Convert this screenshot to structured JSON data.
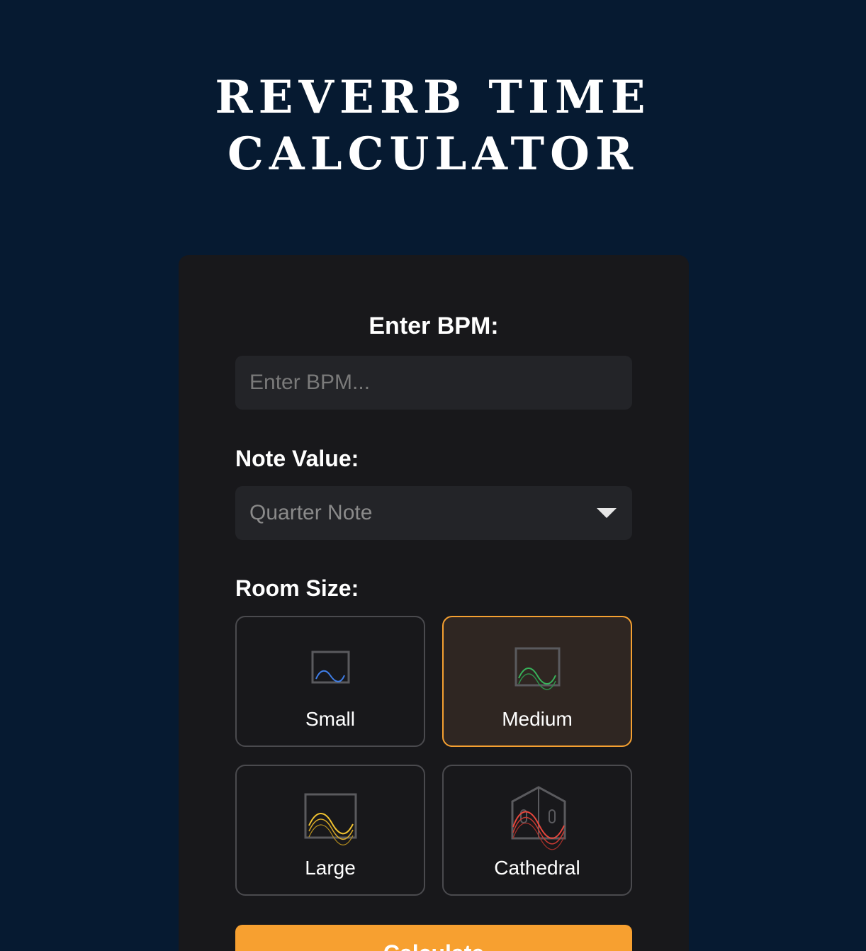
{
  "header": {
    "title_line1": "REVERB TIME",
    "title_line2": "CALCULATOR"
  },
  "form": {
    "bpm_label": "Enter BPM:",
    "bpm_placeholder": "Enter BPM...",
    "bpm_value": "",
    "note_label": "Note Value:",
    "note_selected": "Quarter Note",
    "room_label": "Room Size:",
    "rooms": [
      {
        "label": "Small",
        "selected": false,
        "wave_color": "#3f7ee8"
      },
      {
        "label": "Medium",
        "selected": true,
        "wave_color": "#38b25a"
      },
      {
        "label": "Large",
        "selected": false,
        "wave_color": "#f0c230"
      },
      {
        "label": "Cathedral",
        "selected": false,
        "wave_color": "#e8463c"
      }
    ],
    "calculate_label": "Calculate"
  },
  "colors": {
    "background": "#061a31",
    "card": "#18181b",
    "accent": "#f7a030",
    "field": "#232428"
  }
}
